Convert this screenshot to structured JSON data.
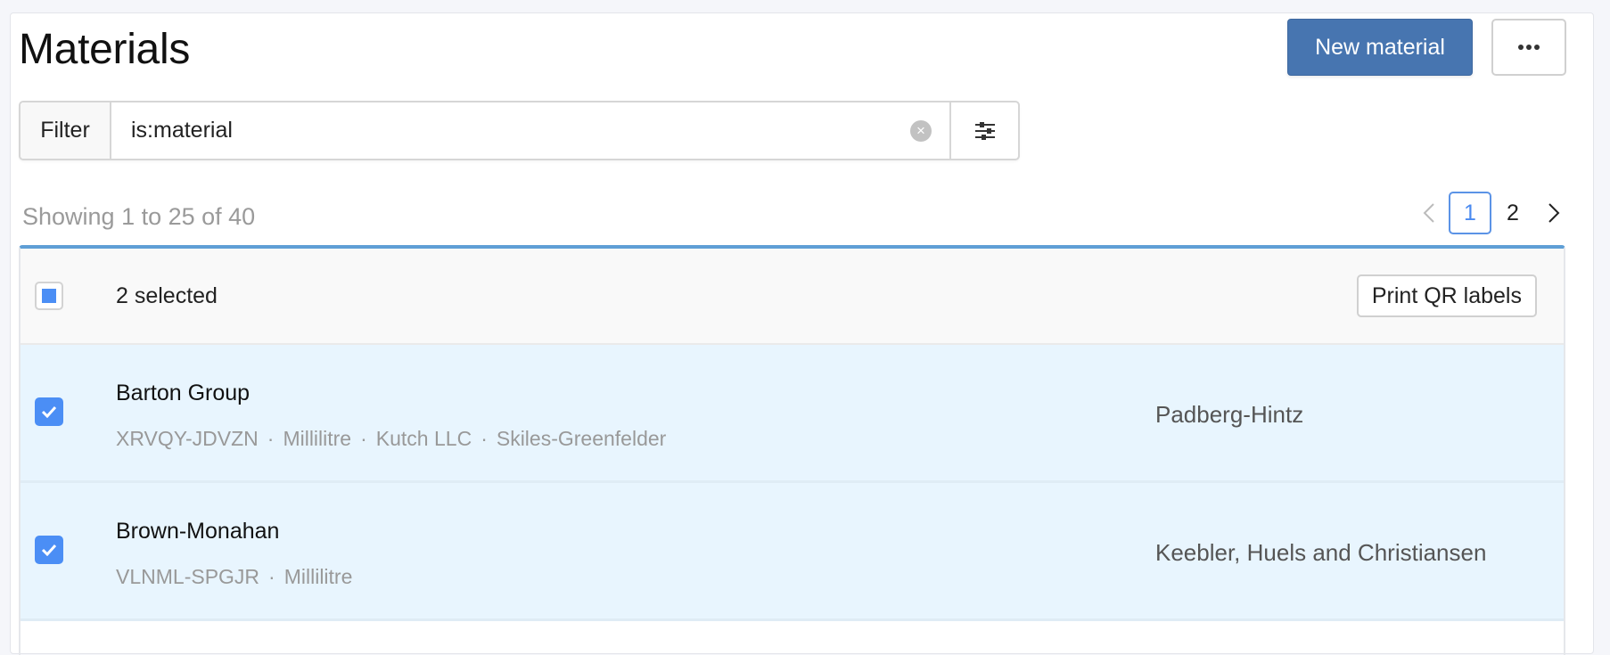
{
  "header": {
    "title": "Materials",
    "new_button": "New material",
    "more_button_icon": "ellipsis-icon"
  },
  "filter": {
    "label": "Filter",
    "value": "is:material",
    "placeholder": "",
    "clear_icon": "clear-icon",
    "settings_icon": "sliders-icon"
  },
  "summary": {
    "showing": "Showing 1 to 25 of 40"
  },
  "pagination": {
    "prev_icon": "chevron-left-icon",
    "pages": [
      "1",
      "2"
    ],
    "current_page": "1",
    "next_icon": "chevron-right-icon"
  },
  "selection": {
    "text": "2 selected",
    "print_button": "Print QR labels"
  },
  "rows": [
    {
      "name": "Barton Group",
      "meta": [
        "XRVQY-JDVZN",
        "Millilitre",
        "Kutch LLC",
        "Skiles-Greenfelder"
      ],
      "supplier": "Padberg-Hintz",
      "checked": true
    },
    {
      "name": "Brown-Monahan",
      "meta": [
        "VLNML-SPGJR",
        "Millilitre"
      ],
      "supplier": "Keebler, Huels and Christiansen",
      "checked": true
    }
  ],
  "colors": {
    "primary": "#4775b0",
    "checkbox": "#4b8ef5",
    "selected_row": "#e8f5fe",
    "table_accent": "#5f9fd6"
  }
}
